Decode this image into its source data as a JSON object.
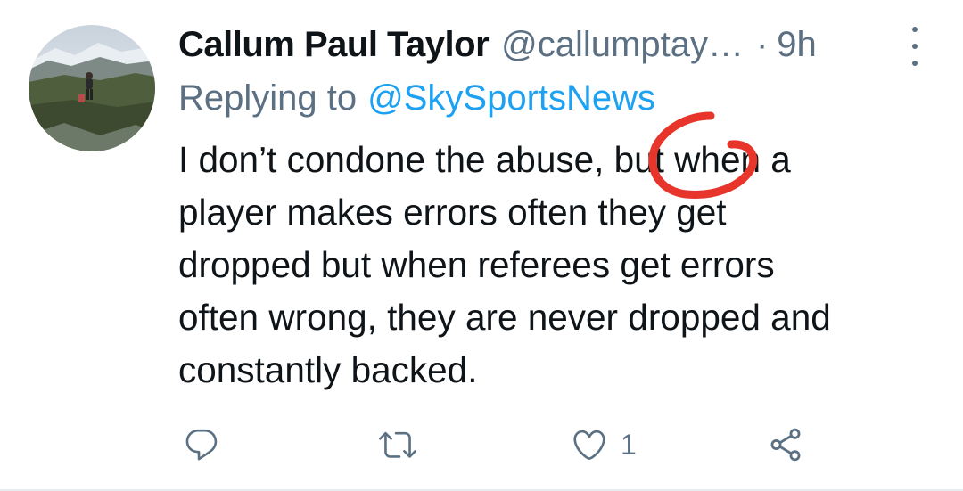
{
  "tweet": {
    "author_name": "Callum Paul Taylor",
    "author_handle": "@callumptay…",
    "separator": "·",
    "time": "9h",
    "reply_prefix": "Replying to",
    "reply_to": "@SkySportsNews",
    "body_lines": [
      "I don’t condone the abuse, but when a",
      "player makes errors often they get",
      "dropped but when referees get errors",
      "often wrong, they are never dropped and",
      "constantly backed."
    ]
  },
  "actions": {
    "reply_icon": "comment-icon",
    "retweet_icon": "retweet-icon",
    "like_icon": "heart-icon",
    "like_count": "1",
    "share_icon": "share-icon"
  },
  "colors": {
    "secondary_text": "#5b7083",
    "link": "#1da1f2",
    "annotation": "#e8352b"
  }
}
